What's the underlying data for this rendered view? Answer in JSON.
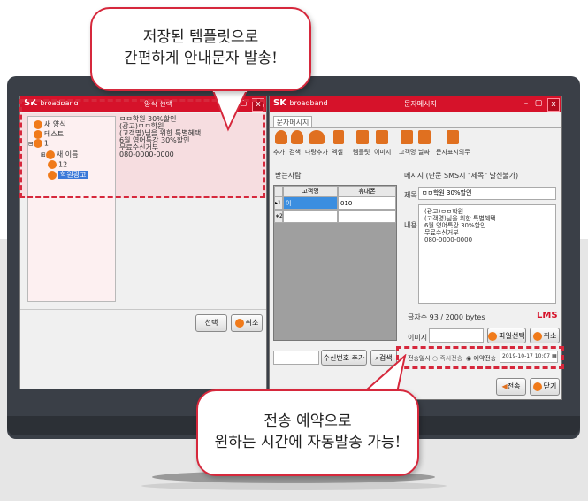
{
  "callout_top": {
    "line1": "저장된 템플릿으로",
    "line2": "간편하게 안내문자 발송!"
  },
  "callout_bottom": {
    "line1": "전송 예약으로",
    "line2": "원하는 시간에 자동발송 가능!"
  },
  "left_window": {
    "brand": "SK",
    "brand_sub": "broadband",
    "title": "양식 선택",
    "tree": {
      "item1": "새 양식",
      "item2": "테스트",
      "item3": "1",
      "item4": "새 이름",
      "item5": "12",
      "item6": "학원광고"
    },
    "preview_lines": [
      "ㅁㅁ학원 30%할인",
      "(광고)ㅁㅁ학원",
      "(고객명)님을 위한 특별혜택",
      "6월 영어특강 30%할인",
      "무료수신거부",
      "080-0000-0000"
    ],
    "select_button": "선택",
    "cancel_button": "취소"
  },
  "right_window": {
    "brand": "SK",
    "brand_sub": "broadband",
    "title": "문자메시지",
    "tab": "문자메시지",
    "toolbar": [
      "추가",
      "검색",
      "다량추가",
      "엑셀",
      "템플릿",
      "이미지",
      "고객명",
      "날짜",
      "문자표시의무"
    ],
    "recipients_label": "받는사람",
    "table": {
      "headers": [
        "고객명",
        "휴대폰"
      ],
      "rows": [
        {
          "marker": "▸1",
          "name": "이",
          "phone": "010"
        },
        {
          "marker": "∗2",
          "name": "",
          "phone": ""
        }
      ]
    },
    "message_header": "메시지 (단문 SMS시 \"제목\" 발신불가)",
    "subject_label": "제목",
    "subject_value": "ㅁㅁ학원 30%할인",
    "content_label": "내용",
    "content_lines": [
      "(광고)ㅁㅁ학원",
      "(고객명)님을 위한 특별혜택",
      "6월 영어특강 30%할인",
      "무료수신거부",
      "080-0000-0000"
    ],
    "char_count": "글자수  93 / 2000 bytes",
    "lms_badge": "LMS",
    "image_label": "이미지",
    "file_select_button": "파일선택",
    "image_cancel_button": "취소",
    "add_number_button": "수신번호 추가",
    "search_button": "검색",
    "send_time_label": "전송일시",
    "radio_immediate": "즉시전송",
    "radio_reserve": "예약전송",
    "reserve_datetime": "2019-10-17 10:07",
    "send_button": "전송",
    "close_button": "닫기"
  },
  "colors": {
    "brand_red": "#d6122a",
    "callout_red": "#d6283c",
    "monitor": "#3a3f47"
  }
}
